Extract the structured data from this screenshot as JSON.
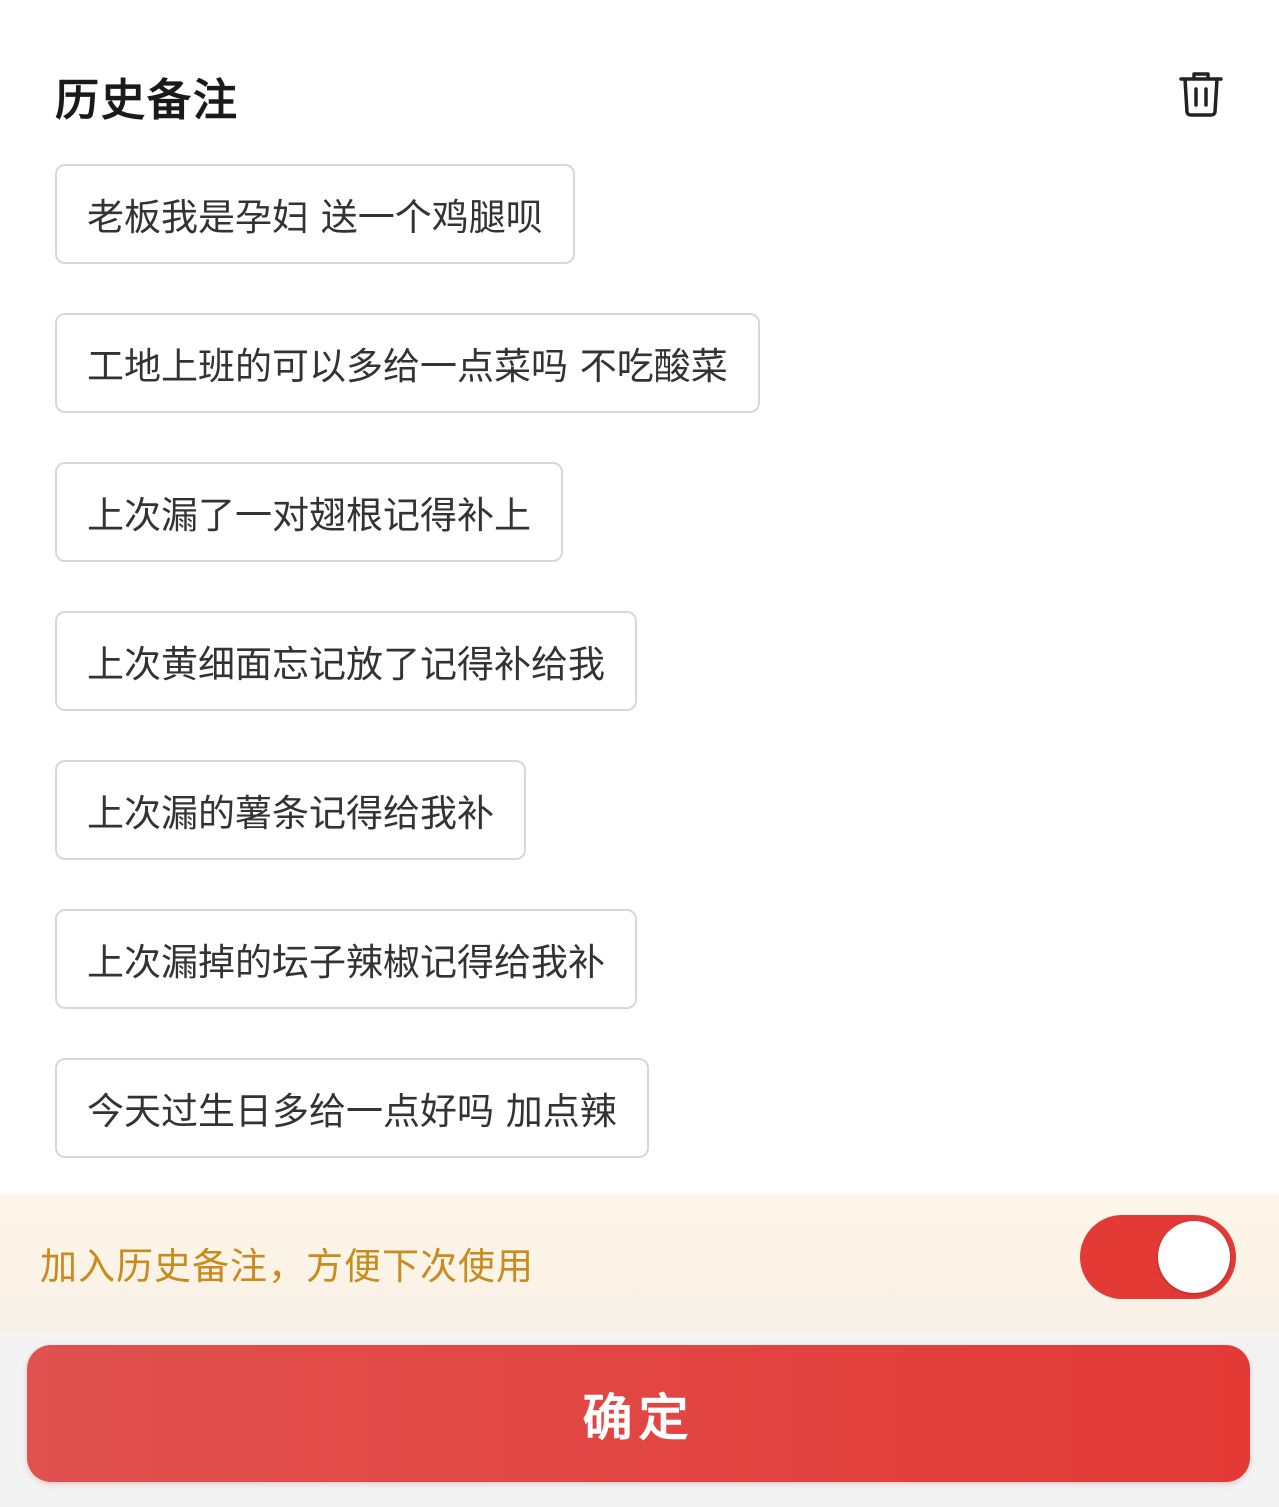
{
  "header": {
    "title": "历史备注",
    "trash_icon": "trash-icon"
  },
  "notes": [
    "老板我是孕妇 送一个鸡腿呗",
    "工地上班的可以多给一点菜吗 不吃酸菜",
    "上次漏了一对翅根记得补上",
    "上次黄细面忘记放了记得补给我",
    "上次漏的薯条记得给我补",
    "上次漏掉的坛子辣椒记得给我补",
    "今天过生日多给一点好吗 加点辣"
  ],
  "save_option": {
    "label": "加入历史备注，方便下次使用",
    "toggle_on": true,
    "toggle_color": "#e33a36"
  },
  "confirm": {
    "label": "确定"
  },
  "colors": {
    "accent": "#e33a36",
    "save_label": "#c98a1e",
    "note_border": "#d8d8dc"
  }
}
